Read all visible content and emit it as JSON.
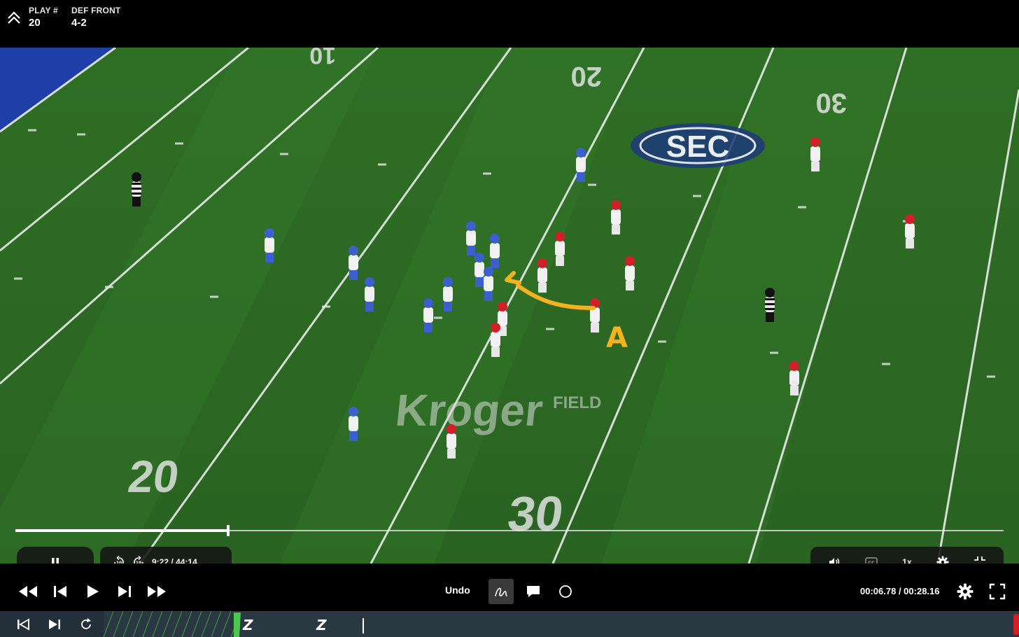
{
  "header": {
    "play_label": "PLAY #",
    "play_value": "20",
    "front_label": "DEF FRONT",
    "front_value": "4-2",
    "collapse_icon": "double-chevron-up-icon"
  },
  "video": {
    "field_numbers": {
      "top_left": "10",
      "top_mid": "20",
      "top_right": "30",
      "bottom_left": "20",
      "bottom_right": "30"
    },
    "logo_text": "SEC",
    "sponsor_text": "Kroger",
    "sponsor_sub": "FIELD",
    "drawing_annotation": "A",
    "colors": {
      "field": "#2e6b25",
      "endzone": "#1f3fa8",
      "annotation": "#f4b21f",
      "home_team": "#3b5fcc",
      "away_team": "#d11f2a"
    }
  },
  "player": {
    "progress": 0.215,
    "elapsed": "9:22",
    "separator": "/",
    "total": "44:14",
    "speed": "1x",
    "icons": {
      "pause": "pause-icon",
      "rewind10": "rewind-10-icon",
      "forward10": "forward-10-icon",
      "volume": "volume-icon",
      "captions": "captions-icon",
      "settings": "gear-icon",
      "exit_fullscreen": "exit-fullscreen-icon"
    }
  },
  "toolbar": {
    "undo_label": "Undo",
    "clip_elapsed": "00:06.78",
    "clip_sep": " / ",
    "clip_total": "00:28.16",
    "icons": {
      "fast_rewind": "fast-rewind-icon",
      "step_back": "step-back-icon",
      "play": "play-icon",
      "step_forward": "step-forward-icon",
      "fast_forward": "fast-forward-icon",
      "draw": "freehand-draw-icon",
      "comment": "comment-icon",
      "circle": "circle-tool-icon",
      "settings": "gear-icon",
      "fullscreen": "fullscreen-icon"
    }
  },
  "timeline": {
    "icons": {
      "prev": "skip-to-start-icon",
      "next": "skip-to-end-icon",
      "loop": "repeat-icon"
    },
    "markers": [
      {
        "label": "Z",
        "color": "#ffffff"
      },
      {
        "label": "Z",
        "color": "#ffffff"
      }
    ],
    "accent_color": "#4cc94c"
  }
}
